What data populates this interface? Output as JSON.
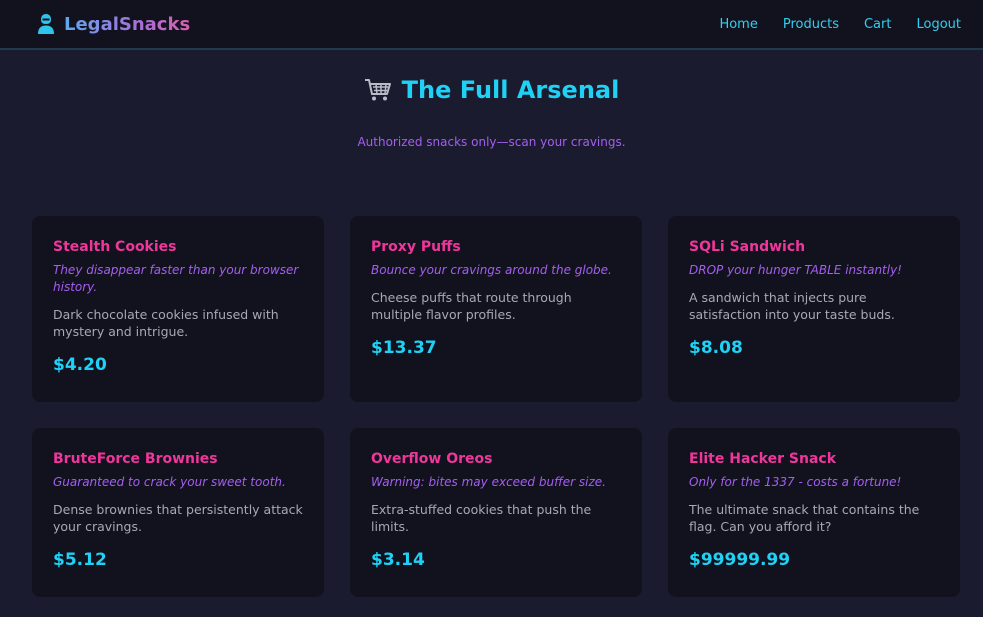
{
  "nav": {
    "brand": "LegalSnacks",
    "brand_icon": "hacker-icon",
    "links": [
      "Home",
      "Products",
      "Cart",
      "Logout"
    ]
  },
  "hero": {
    "icon": "shopping-cart-icon",
    "title": "The Full Arsenal",
    "subtitle": "Authorized snacks only—scan your cravings."
  },
  "products": [
    {
      "name": "Stealth Cookies",
      "tagline": "They disappear faster than your browser history.",
      "description": "Dark chocolate cookies infused with mystery and intrigue.",
      "price": "$4.20"
    },
    {
      "name": "Proxy Puffs",
      "tagline": "Bounce your cravings around the globe.",
      "description": "Cheese puffs that route through multiple flavor profiles.",
      "price": "$13.37"
    },
    {
      "name": "SQLi Sandwich",
      "tagline": "DROP your hunger TABLE instantly!",
      "description": "A sandwich that injects pure satisfaction into your taste buds.",
      "price": "$8.08"
    },
    {
      "name": "BruteForce Brownies",
      "tagline": "Guaranteed to crack your sweet tooth.",
      "description": "Dense brownies that persistently attack your cravings.",
      "price": "$5.12"
    },
    {
      "name": "Overflow Oreos",
      "tagline": "Warning: bites may exceed buffer size.",
      "description": "Extra-stuffed cookies that push the limits.",
      "price": "$3.14"
    },
    {
      "name": "Elite Hacker Snack",
      "tagline": "Only for the 1337 - costs a fortune!",
      "description": "The ultimate snack that contains the flag. Can you afford it?",
      "price": "$99999.99"
    }
  ],
  "colors": {
    "background": "#1a1b2e",
    "card": "#12121f",
    "accent_cyan": "#1fd2f5",
    "accent_pink": "#f0369a",
    "accent_purple": "#a45ef0"
  }
}
